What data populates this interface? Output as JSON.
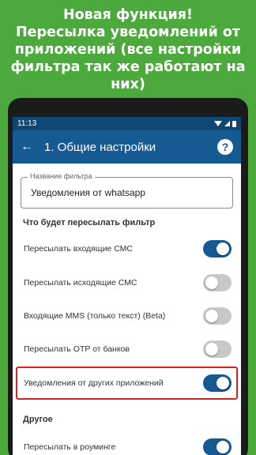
{
  "promo": {
    "line1": "Новая функция!",
    "line2": "Пересылка уведомлений от",
    "line3": "приложений (все настройки",
    "line4": "фильтра так же работают на них)"
  },
  "status": {
    "time": "11:13"
  },
  "appbar": {
    "back_icon": "arrow-left-icon",
    "title": "1. Общие настройки",
    "help_icon": "help-circle-icon",
    "help_glyph": "?"
  },
  "filter_name": {
    "label": "Название фильтра",
    "value": "Уведомления от whatsapp"
  },
  "sections": {
    "forward_title": "Что будет пересылать фильтр",
    "other_title": "Другое"
  },
  "settings": [
    {
      "label": "Пересылать входящие СМС",
      "enabled": true
    },
    {
      "label": "Пересылать исходящие СМС",
      "enabled": false
    },
    {
      "label": "Входящие MMS (только текст) (Beta)",
      "enabled": false
    },
    {
      "label": "Пересылать OTP от банков",
      "enabled": false
    },
    {
      "label": "Уведомления от других приложений",
      "enabled": true
    }
  ],
  "other_settings": [
    {
      "label": "Пересылать в роуминге",
      "enabled": true
    }
  ],
  "colors": {
    "background": "#4caa3c",
    "app_primary": "#155a93",
    "highlight": "#d82222"
  }
}
